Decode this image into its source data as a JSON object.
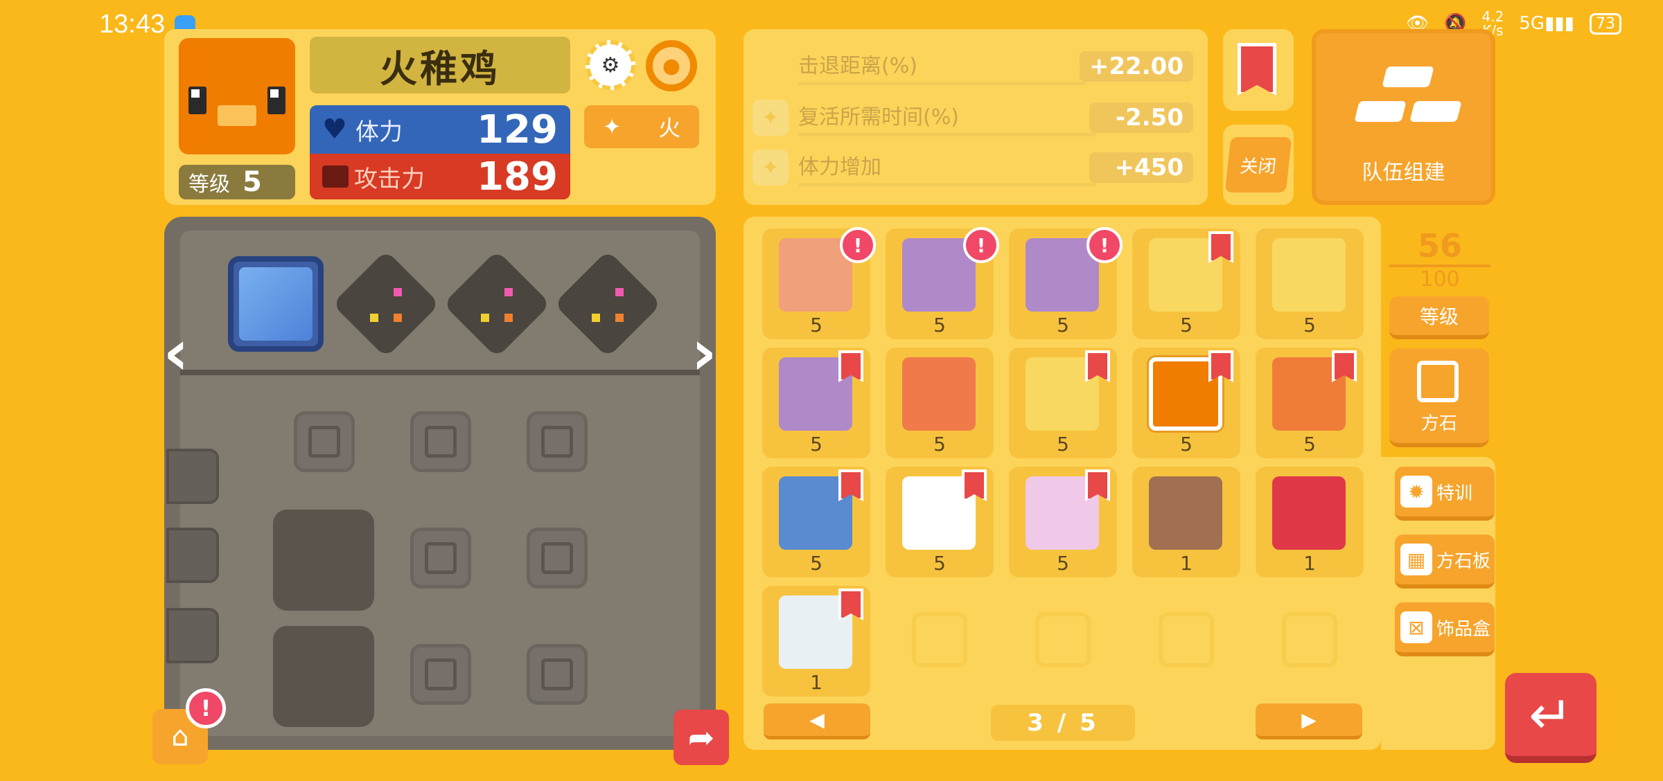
{
  "status_bar": {
    "time": "13:43",
    "net_speed_top": "4.2",
    "net_speed_bottom": "K/s",
    "signal": "5G",
    "battery": "73"
  },
  "profile": {
    "name": "火稚鸡",
    "level_label": "等级",
    "level_value": "5",
    "hp_label": "体力",
    "hp_value": "129",
    "atk_label": "攻击力",
    "atk_value": "189",
    "type_label": "火",
    "avatar_color": "#f07c00"
  },
  "bonus_stats": [
    {
      "label": "击退距离(%)",
      "value": "+22.00"
    },
    {
      "label": "复活所需时间(%)",
      "value": "-2.50"
    },
    {
      "label": "体力增加",
      "value": "+450"
    }
  ],
  "close_label": "关闭",
  "team_label": "队伍组建",
  "box": {
    "count_current": "56",
    "count_max": "100",
    "level_button": "等级",
    "stone_button": "方石",
    "page_text": "3 / 5",
    "prev_label": "◀",
    "next_label": "▶",
    "pokemon": [
      {
        "level": "5",
        "color": "#f0a07a",
        "badge": "alert"
      },
      {
        "level": "5",
        "color": "#b089c8",
        "badge": "alert"
      },
      {
        "level": "5",
        "color": "#b089c8",
        "badge": "alert"
      },
      {
        "level": "5",
        "color": "#f8d860",
        "badge": "star"
      },
      {
        "level": "5",
        "color": "#f8d860",
        "badge": "none"
      },
      {
        "level": "5",
        "color": "#b089c8",
        "badge": "star"
      },
      {
        "level": "5",
        "color": "#f07a4a",
        "badge": "none"
      },
      {
        "level": "5",
        "color": "#f8d860",
        "badge": "star"
      },
      {
        "level": "5",
        "color": "#f07c00",
        "badge": "star"
      },
      {
        "level": "5",
        "color": "#f07c3a",
        "badge": "star"
      },
      {
        "level": "5",
        "color": "#5a8ad0",
        "badge": "star"
      },
      {
        "level": "5",
        "color": "#ffffff",
        "badge": "star"
      },
      {
        "level": "5",
        "color": "#f0c8e8",
        "badge": "star"
      },
      {
        "level": "1",
        "color": "#a07050",
        "badge": "none"
      },
      {
        "level": "1",
        "color": "#e03848",
        "badge": "none"
      },
      {
        "level": "1",
        "color": "#e8f0f4",
        "badge": "star"
      }
    ]
  },
  "side_buttons": [
    {
      "label": "特训",
      "icon": "gear-icon"
    },
    {
      "label": "方石板",
      "icon": "grid-icon"
    },
    {
      "label": "饰品盒",
      "icon": "gift-icon"
    }
  ],
  "alerts": {
    "cook": "!",
    "excl": "!"
  }
}
